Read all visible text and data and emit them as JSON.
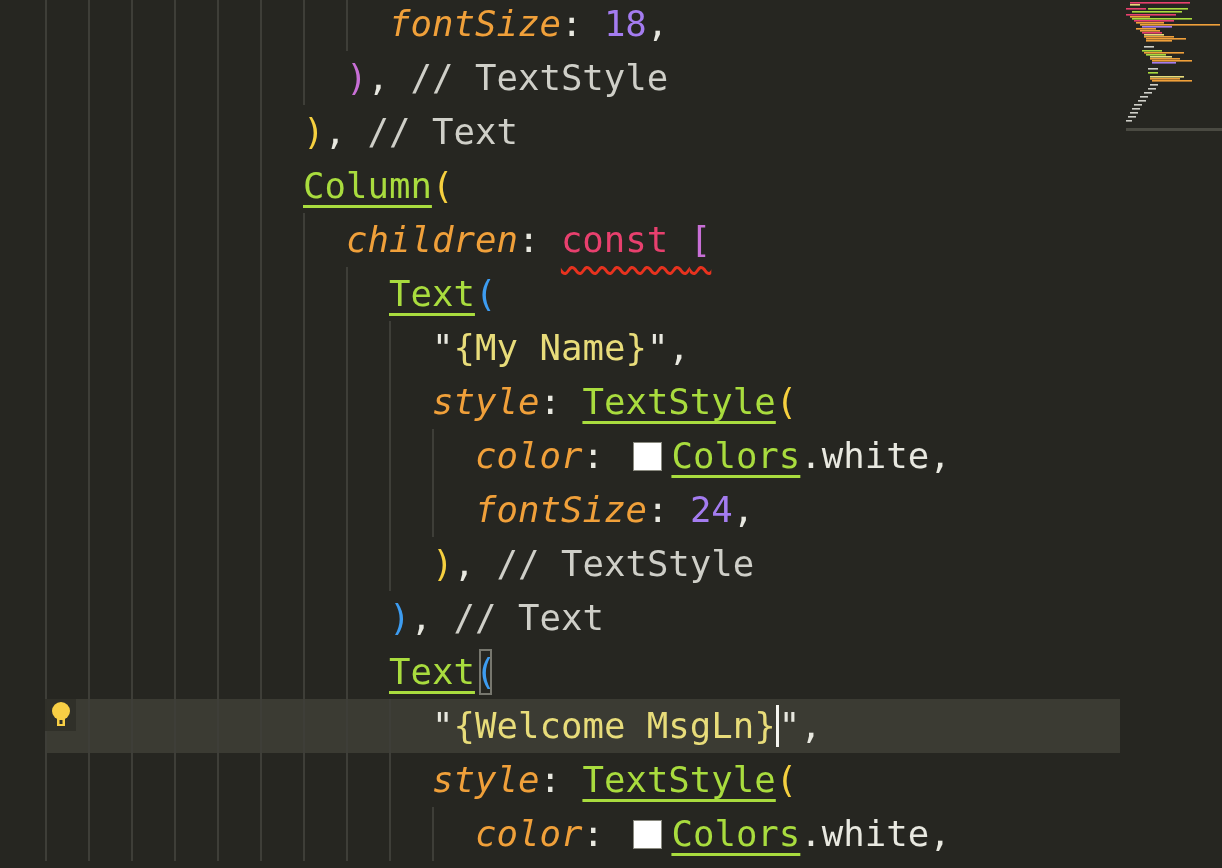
{
  "editor": {
    "lines": [
      {
        "children": [
          {
            "children": [
              {
                "children": [
                  {
                    "children": [
                      {
                        "children": [
                          {
                            "children": [
                              {
                                "children": [
                                  {
                                    "children": [
                                      {
                                        "tokens": [
                                          {
                                            "t": "fontSize",
                                            "kind": "prop"
                                          },
                                          {
                                            "t": ": ",
                                            "kind": "punct"
                                          },
                                          {
                                            "t": "18",
                                            "kind": "num"
                                          },
                                          {
                                            "t": ",",
                                            "kind": "punct"
                                          }
                                        ]
                                      }
                                    ]
                                  },
                                  {
                                    "tokens": [
                                      {
                                        "t": ")",
                                        "kind": "bracket",
                                        "color": "#c86fd6"
                                      },
                                      {
                                        "t": ", ",
                                        "kind": "punct"
                                      },
                                      {
                                        "t": "// TextStyle",
                                        "kind": "comment"
                                      }
                                    ]
                                  }
                                ]
                              },
                              {
                                "tokens": [
                                  {
                                    "t": ")",
                                    "kind": "bracket",
                                    "color": "#f6d03f"
                                  },
                                  {
                                    "t": ", ",
                                    "kind": "punct"
                                  },
                                  {
                                    "t": "// Text",
                                    "kind": "comment"
                                  }
                                ]
                              },
                              {
                                "tokens": [
                                  {
                                    "t": "Column",
                                    "kind": "cls"
                                  },
                                  {
                                    "t": "(",
                                    "kind": "bracket",
                                    "color": "#f6d03f"
                                  }
                                ]
                              },
                              {
                                "children": [
                                  {
                                    "tokens": [
                                      {
                                        "t": "children",
                                        "kind": "prop"
                                      },
                                      {
                                        "t": ": ",
                                        "kind": "punct"
                                      },
                                      {
                                        "t": "const ",
                                        "kind": "kw",
                                        "error": true
                                      },
                                      {
                                        "t": "[",
                                        "kind": "bracket",
                                        "color": "#c86fd6",
                                        "error": true
                                      }
                                    ]
                                  },
                                  {
                                    "children": [
                                      {
                                        "tokens": [
                                          {
                                            "t": "Text",
                                            "kind": "cls"
                                          },
                                          {
                                            "t": "(",
                                            "kind": "bracket",
                                            "color": "#3d9cf0"
                                          }
                                        ]
                                      },
                                      {
                                        "children": [
                                          {
                                            "tokens": [
                                              {
                                                "t": "\"",
                                                "kind": "punct"
                                              },
                                              {
                                                "t": "{My Name}",
                                                "kind": "str"
                                              },
                                              {
                                                "t": "\",",
                                                "kind": "punct"
                                              }
                                            ]
                                          },
                                          {
                                            "tokens": [
                                              {
                                                "t": "style",
                                                "kind": "prop"
                                              },
                                              {
                                                "t": ": ",
                                                "kind": "punct"
                                              },
                                              {
                                                "t": "TextStyle",
                                                "kind": "cls"
                                              },
                                              {
                                                "t": "(",
                                                "kind": "bracket",
                                                "color": "#f6d03f"
                                              }
                                            ]
                                          },
                                          {
                                            "children": [
                                              {
                                                "tokens": [
                                                  {
                                                    "t": "color",
                                                    "kind": "prop"
                                                  },
                                                  {
                                                    "t": ": ",
                                                    "kind": "punct"
                                                  },
                                                  {
                                                    "kind": "swatch",
                                                    "color": "#ffffff"
                                                  },
                                                  {
                                                    "t": "Colors",
                                                    "kind": "cls"
                                                  },
                                                  {
                                                    "t": ".white,",
                                                    "kind": "punct"
                                                  }
                                                ]
                                              },
                                              {
                                                "tokens": [
                                                  {
                                                    "t": "fontSize",
                                                    "kind": "prop"
                                                  },
                                                  {
                                                    "t": ": ",
                                                    "kind": "punct"
                                                  },
                                                  {
                                                    "t": "24",
                                                    "kind": "num"
                                                  },
                                                  {
                                                    "t": ",",
                                                    "kind": "punct"
                                                  }
                                                ]
                                              }
                                            ]
                                          },
                                          {
                                            "tokens": [
                                              {
                                                "t": ")",
                                                "kind": "bracket",
                                                "color": "#f6d03f"
                                              },
                                              {
                                                "t": ", ",
                                                "kind": "punct"
                                              },
                                              {
                                                "t": "// TextStyle",
                                                "kind": "comment"
                                              }
                                            ]
                                          }
                                        ]
                                      },
                                      {
                                        "tokens": [
                                          {
                                            "t": ")",
                                            "kind": "bracket",
                                            "color": "#3d9cf0"
                                          },
                                          {
                                            "t": ", ",
                                            "kind": "punct"
                                          },
                                          {
                                            "t": "// Text",
                                            "kind": "comment"
                                          }
                                        ]
                                      },
                                      {
                                        "tokens": [
                                          {
                                            "t": "Text",
                                            "kind": "cls"
                                          },
                                          {
                                            "t": "(",
                                            "kind": "bracket",
                                            "color": "#3d9cf0",
                                            "matched": true
                                          }
                                        ]
                                      },
                                      {
                                        "children": [
                                          {
                                            "current": true,
                                            "lightbulb": true,
                                            "tokens": [
                                              {
                                                "t": "\"",
                                                "kind": "punct"
                                              },
                                              {
                                                "t": "{Welcome MsgLn}",
                                                "kind": "str",
                                                "cursor": true
                                              },
                                              {
                                                "t": "\",",
                                                "kind": "punct"
                                              }
                                            ]
                                          },
                                          {
                                            "tokens": [
                                              {
                                                "t": "style",
                                                "kind": "prop"
                                              },
                                              {
                                                "t": ": ",
                                                "kind": "punct"
                                              },
                                              {
                                                "t": "TextStyle",
                                                "kind": "cls"
                                              },
                                              {
                                                "t": "(",
                                                "kind": "bracket",
                                                "color": "#f6d03f"
                                              }
                                            ]
                                          },
                                          {
                                            "children": [
                                              {
                                                "tokens": [
                                                  {
                                                    "t": "color",
                                                    "kind": "prop"
                                                  },
                                                  {
                                                    "t": ": ",
                                                    "kind": "punct"
                                                  },
                                                  {
                                                    "kind": "swatch",
                                                    "color": "#ffffff"
                                                  },
                                                  {
                                                    "t": "Colors",
                                                    "kind": "cls"
                                                  },
                                                  {
                                                    "t": ".white,",
                                                    "kind": "punct"
                                                  }
                                                ]
                                              }
                                            ]
                                          }
                                        ]
                                      }
                                    ]
                                  }
                                ]
                              }
                            ]
                          }
                        ]
                      }
                    ]
                  }
                ]
              }
            ]
          }
        ]
      }
    ]
  }
}
